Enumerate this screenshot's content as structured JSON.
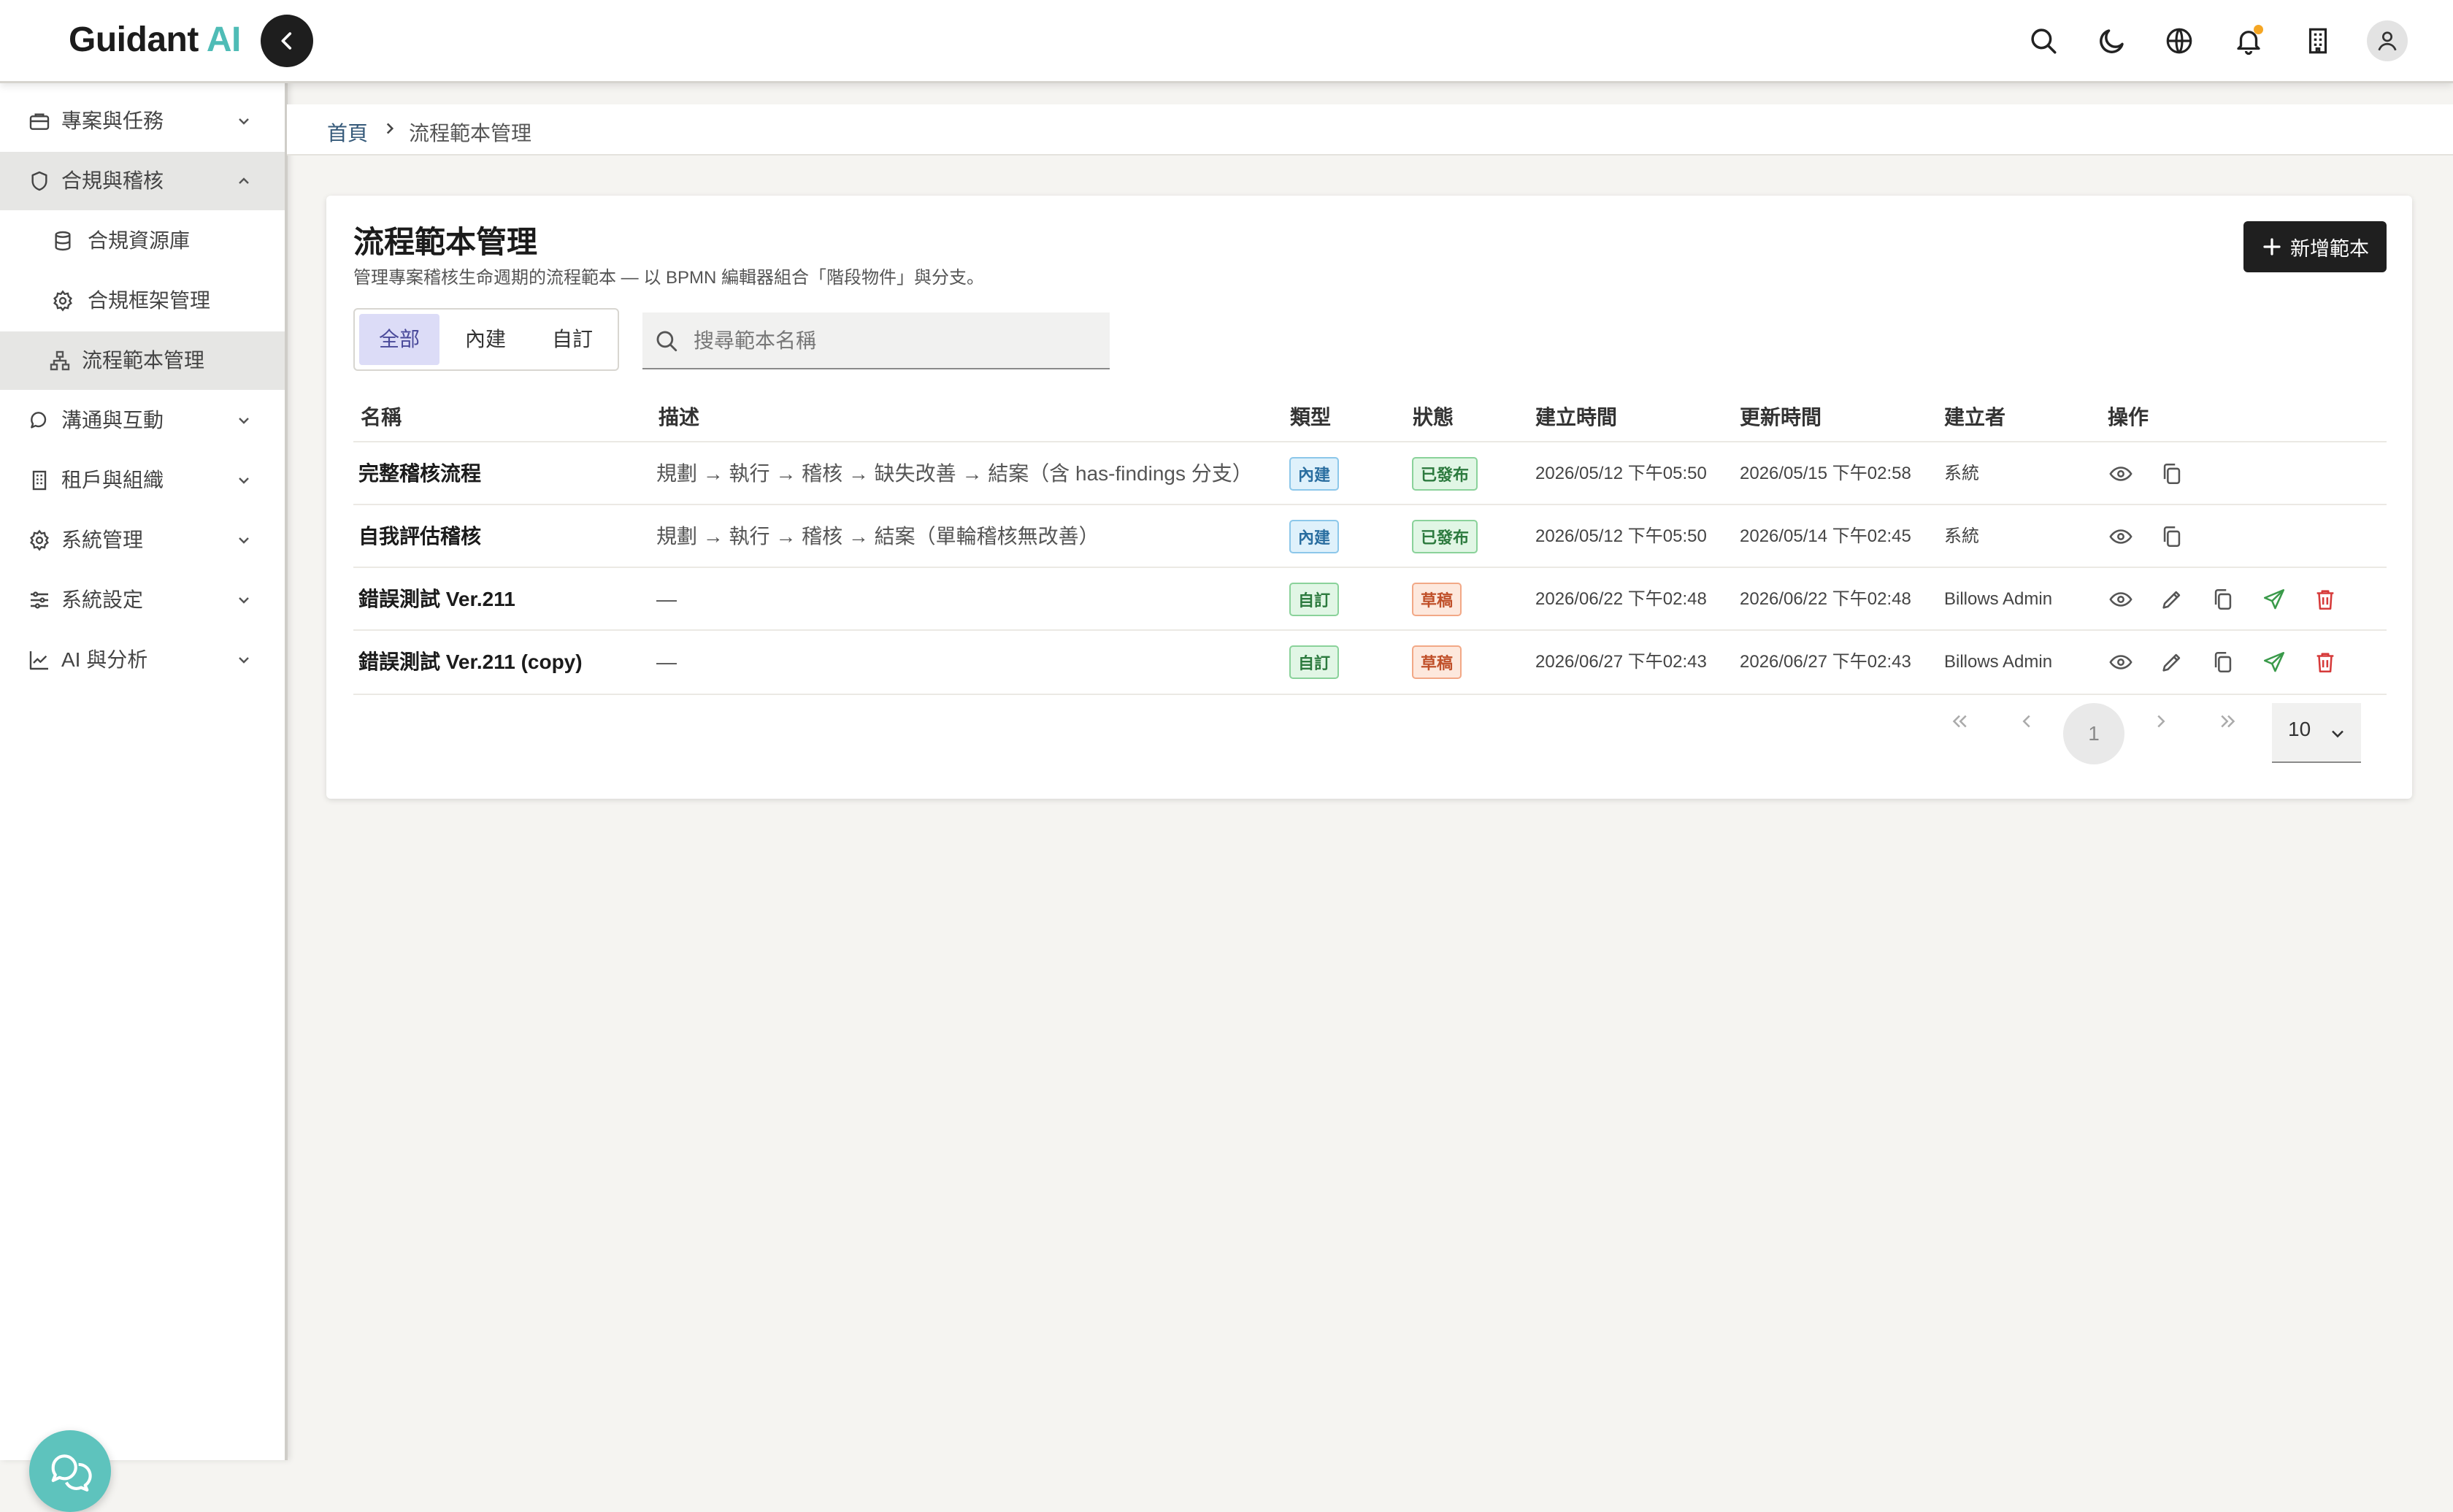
{
  "header": {
    "brand_main": "Guidant",
    "brand_accent": "AI"
  },
  "sidebar": {
    "items": [
      {
        "label": "專案與任務"
      },
      {
        "label": "合規與稽核"
      },
      {
        "label": "合規資源庫"
      },
      {
        "label": "合規框架管理"
      },
      {
        "label": "流程範本管理"
      },
      {
        "label": "溝通與互動"
      },
      {
        "label": "租戶與組織"
      },
      {
        "label": "系統管理"
      },
      {
        "label": "系統設定"
      },
      {
        "label": "AI 與分析"
      }
    ]
  },
  "breadcrumb": {
    "home": "首頁",
    "current": "流程範本管理"
  },
  "page": {
    "title": "流程範本管理",
    "description": "管理專案稽核生命週期的流程範本 — 以 BPMN 編輯器組合「階段物件」與分支。",
    "add_button": "新增範本"
  },
  "filters": {
    "segments": [
      "全部",
      "內建",
      "自訂"
    ],
    "active_segment": "全部",
    "search_placeholder": "搜尋範本名稱",
    "search_value": ""
  },
  "table": {
    "columns": [
      "名稱",
      "描述",
      "類型",
      "狀態",
      "建立時間",
      "更新時間",
      "建立者",
      "操作"
    ],
    "rows": [
      {
        "name": "完整稽核流程",
        "description": "規劃 → 執行 → 稽核 → 缺失改善 → 結案（含 has-findings 分支）",
        "type": "內建",
        "status": "已發布",
        "created": "2026/05/12 下午05:50",
        "updated": "2026/05/15 下午02:58",
        "creator": "系統"
      },
      {
        "name": "自我評估稽核",
        "description": "規劃 → 執行 → 稽核 → 結案（單輪稽核無改善）",
        "type": "內建",
        "status": "已發布",
        "created": "2026/05/12 下午05:50",
        "updated": "2026/05/14 下午02:45",
        "creator": "系統"
      },
      {
        "name": "錯誤測試 Ver.211",
        "description": "—",
        "type": "自訂",
        "status": "草稿",
        "created": "2026/06/22 下午02:48",
        "updated": "2026/06/22 下午02:48",
        "creator": "Billows Admin"
      },
      {
        "name": "錯誤測試 Ver.211 (copy)",
        "description": "—",
        "type": "自訂",
        "status": "草稿",
        "created": "2026/06/27 下午02:43",
        "updated": "2026/06/27 下午02:43",
        "creator": "Billows Admin"
      }
    ]
  },
  "pagination": {
    "current_page": "1",
    "page_size": "10"
  },
  "colors": {
    "brand_accent": "#4fbcb6",
    "primary_button": "#1f1f1f",
    "active_segment_bg": "#dcdcf7",
    "draft_badge": "#c0502a",
    "published_badge": "#2c7a3e",
    "delete_icon": "#d63a3a",
    "send_icon": "#3a9a4a"
  },
  "icons": {
    "header": [
      "search-icon",
      "moon-icon",
      "globe-icon",
      "bell-icon",
      "building-icon",
      "user-icon"
    ],
    "row_actions": [
      "eye-icon",
      "pencil-icon",
      "copy-icon",
      "send-icon",
      "trash-icon"
    ]
  }
}
